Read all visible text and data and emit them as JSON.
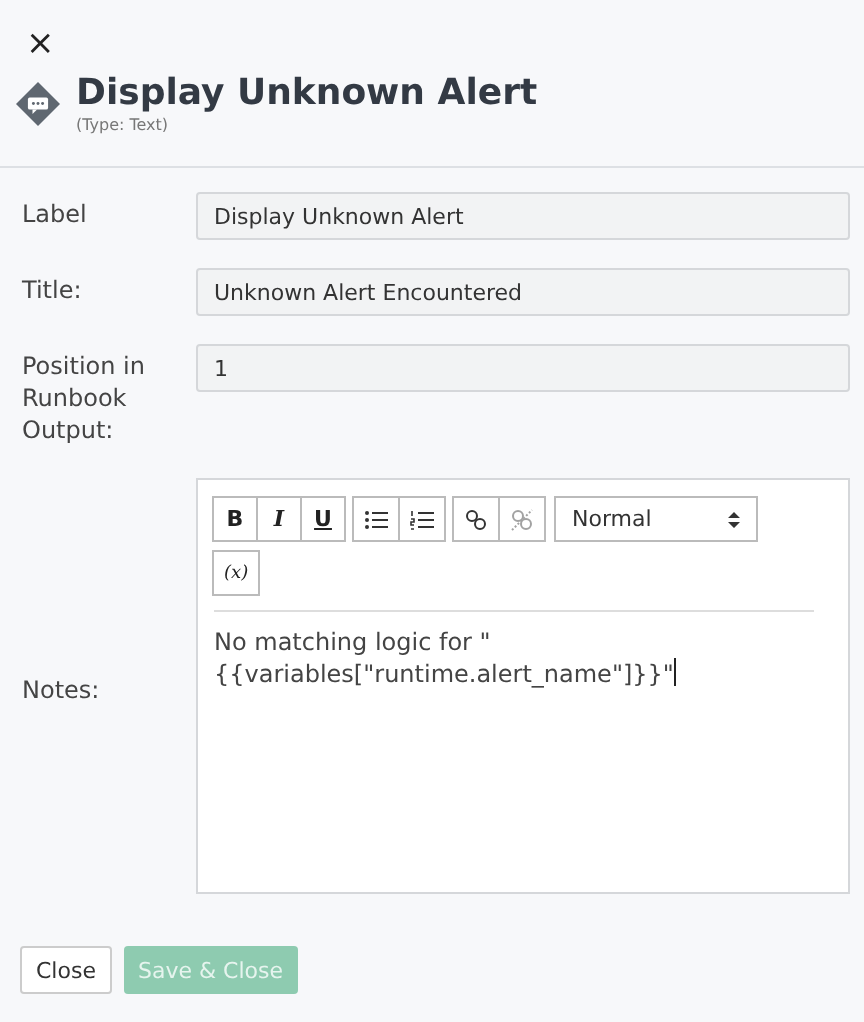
{
  "close_icon": "×",
  "header": {
    "title": "Display Unknown Alert",
    "subtitle": "(Type: Text)"
  },
  "fields": [
    {
      "label": "Label",
      "value": "Display Unknown Alert"
    },
    {
      "label": "Title:",
      "value": "Unknown Alert Encountered"
    },
    {
      "label": "Position in Runbook Output:",
      "value": "1"
    }
  ],
  "notes": {
    "label": "Notes:",
    "toolbar": [
      [
        {
          "kind": "text",
          "label": "B"
        },
        {
          "kind": "text",
          "label": "I"
        },
        {
          "kind": "text",
          "label": "U"
        }
      ],
      [
        {
          "kind": "bullets"
        },
        {
          "kind": "numbers"
        }
      ],
      [
        {
          "kind": "link",
          "disabled": false
        },
        {
          "kind": "unlink",
          "disabled": true
        }
      ]
    ],
    "format": "Normal",
    "variable_button": "(x)",
    "content": "No matching logic for \"{{variables[\"runtime.alert_name\"]}}\""
  },
  "buttons": [
    {
      "label": "Close",
      "disabled": false,
      "kind": "secondary"
    },
    {
      "label": "Save & Close",
      "disabled": true,
      "kind": "primary"
    }
  ]
}
